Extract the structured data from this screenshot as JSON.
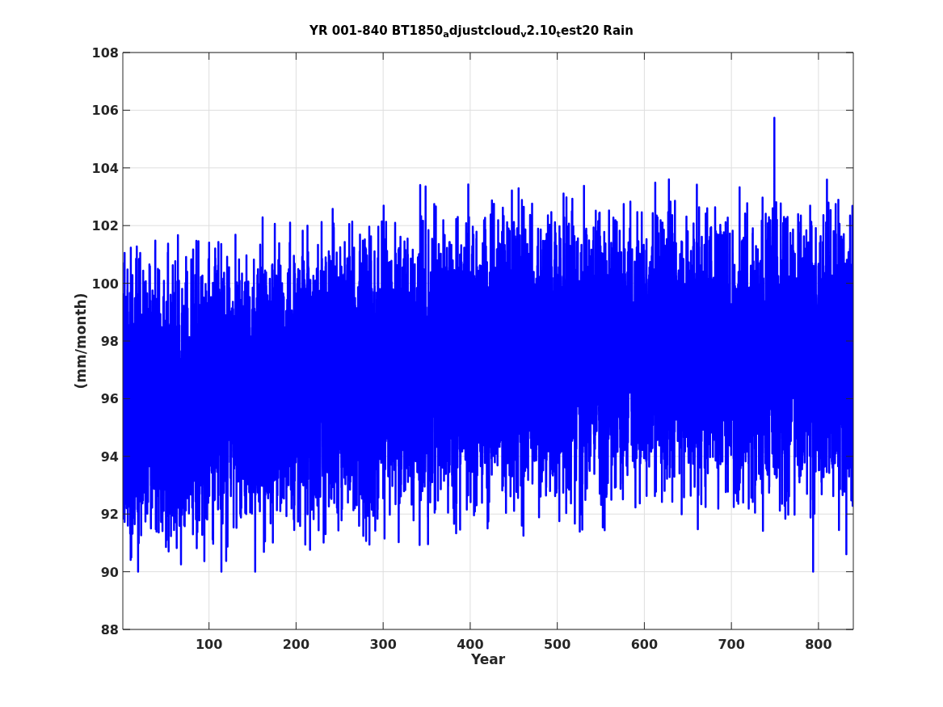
{
  "figure": {
    "title": "YR 001-840 BT1850$_{a}$djustcloud$_{v}$2.10$_{t}$est20 Rain",
    "xlabel": "Year",
    "ylabel": "(mm/month)",
    "xticks": [
      "100",
      "200",
      "300",
      "400",
      "500",
      "600",
      "700",
      "800"
    ],
    "yticks": [
      "108",
      "106",
      "104",
      "102",
      "100",
      "98",
      "96",
      "94",
      "92",
      "90",
      "88"
    ]
  }
}
